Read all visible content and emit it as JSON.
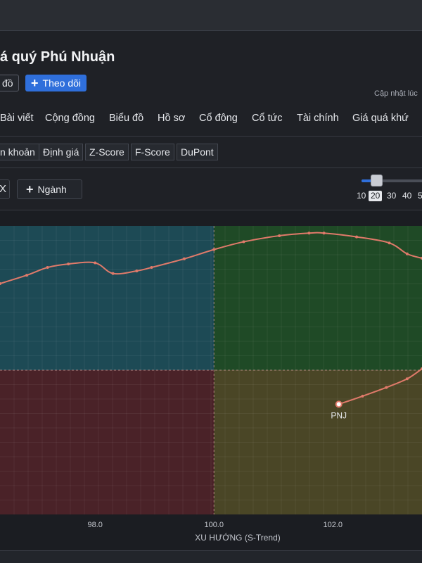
{
  "header": {
    "title": "á quý Phú Nhuận",
    "map_button": "đồ",
    "follow_button": "Theo dõi",
    "updated": "Cập nhật lúc"
  },
  "nav_tabs": [
    "Bài viết",
    "Cộng đồng",
    "Biểu đồ",
    "Hồ sơ",
    "Cổ đông",
    "Cổ tức",
    "Tài chính",
    "Giá quá khứ"
  ],
  "sub_tabs": [
    "n khoản",
    "Định giá",
    "Z-Score",
    "F-Score",
    "DuPont"
  ],
  "controls": {
    "close_label": "X",
    "industry_button": "Ngành",
    "slider_options": [
      "10",
      "20",
      "30",
      "40",
      "5"
    ],
    "slider_selected": "20",
    "slider_fraction": 0.15
  },
  "colors": {
    "quadrant_top_left": "#1d4a55",
    "quadrant_top_right": "#1f4a26",
    "quadrant_bottom_left": "#4a2228",
    "quadrant_bottom_right": "#4a4626",
    "line": "#e07a6a",
    "accent": "#2f6fdb"
  },
  "chart_data": {
    "type": "line",
    "xlabel": "XU HƯỚNG (S-Trend)",
    "x_ticks": [
      98.0,
      100.0,
      102.0
    ],
    "xlim": [
      96.4,
      103.5
    ],
    "ylim": [
      0,
      100
    ],
    "grid": true,
    "center": {
      "x": 100.0,
      "y": 50
    },
    "series": [
      {
        "name": "",
        "points": [
          {
            "x": 96.4,
            "y": 80.0
          },
          {
            "x": 96.85,
            "y": 82.9
          },
          {
            "x": 97.2,
            "y": 85.6
          },
          {
            "x": 97.55,
            "y": 86.8
          },
          {
            "x": 98.0,
            "y": 87.2
          },
          {
            "x": 98.3,
            "y": 83.5
          },
          {
            "x": 98.7,
            "y": 84.4
          },
          {
            "x": 98.95,
            "y": 85.6
          },
          {
            "x": 99.5,
            "y": 88.6
          },
          {
            "x": 100.0,
            "y": 91.8
          },
          {
            "x": 100.5,
            "y": 94.5
          },
          {
            "x": 101.1,
            "y": 96.6
          },
          {
            "x": 101.6,
            "y": 97.5
          },
          {
            "x": 101.85,
            "y": 97.5
          },
          {
            "x": 102.4,
            "y": 96.2
          },
          {
            "x": 102.95,
            "y": 94.1
          },
          {
            "x": 103.25,
            "y": 90.3
          },
          {
            "x": 103.5,
            "y": 88.8
          }
        ]
      },
      {
        "name": "PNJ",
        "points": [
          {
            "x": 103.5,
            "y": 50.5
          },
          {
            "x": 103.25,
            "y": 47.0
          },
          {
            "x": 102.9,
            "y": 44.0
          },
          {
            "x": 102.5,
            "y": 41.0
          },
          {
            "x": 102.1,
            "y": 38.2
          }
        ],
        "label": "PNJ"
      }
    ]
  }
}
